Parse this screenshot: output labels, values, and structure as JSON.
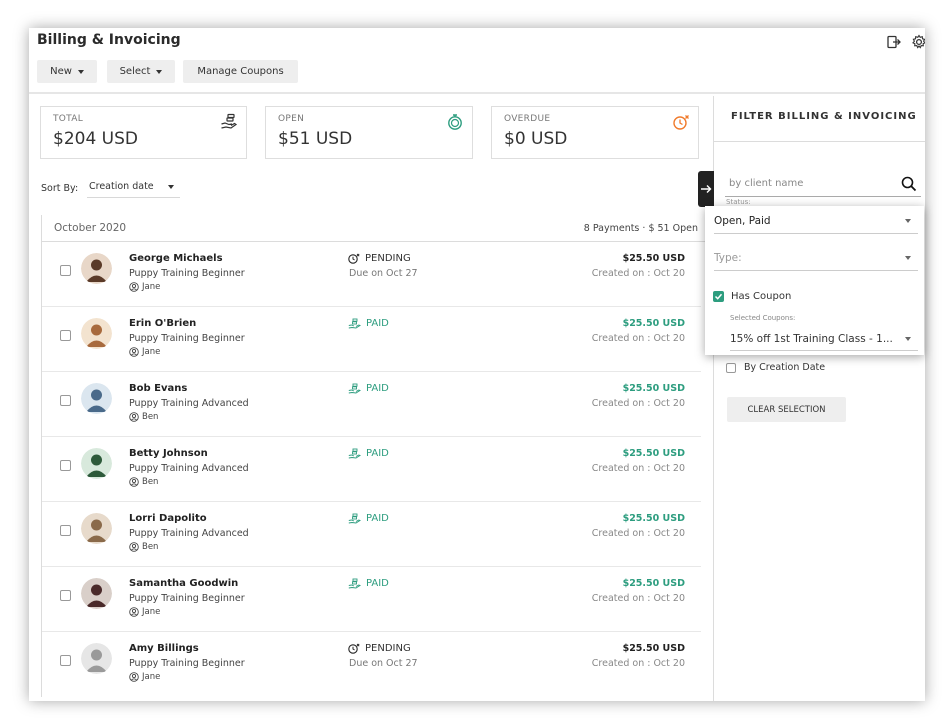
{
  "header": {
    "title": "Billing & Invoicing",
    "buttons": {
      "new": "New",
      "select": "Select",
      "manage_coupons": "Manage Coupons"
    }
  },
  "summary": [
    {
      "label": "TOTAL",
      "value": "$204 USD",
      "icon": "hand-money-icon",
      "color": "#333333"
    },
    {
      "label": "OPEN",
      "value": "$51 USD",
      "icon": "stopwatch-icon",
      "color": "#2d9d7f"
    },
    {
      "label": "OVERDUE",
      "value": "$0 USD",
      "icon": "clock-alert-icon",
      "color": "#f07a2b"
    }
  ],
  "sort": {
    "label": "Sort By:",
    "value": "Creation date"
  },
  "group": {
    "month": "October 2020",
    "summary": "8 Payments   ·  $ 51 Open"
  },
  "payments": [
    {
      "name": "George Michaels",
      "plan": "Puppy Training Beginner",
      "trainer": "Jane",
      "status": "PENDING",
      "due": "Due on Oct 27",
      "amount": "$25.50 USD",
      "created": "Created on : Oct 20"
    },
    {
      "name": "Erin O'Brien",
      "plan": "Puppy Training Beginner",
      "trainer": "Jane",
      "status": "PAID",
      "due": "",
      "amount": "$25.50 USD",
      "created": "Created on : Oct 20"
    },
    {
      "name": "Bob Evans",
      "plan": "Puppy Training Advanced",
      "trainer": "Ben",
      "status": "PAID",
      "due": "",
      "amount": "$25.50 USD",
      "created": "Created on : Oct 20"
    },
    {
      "name": "Betty Johnson",
      "plan": "Puppy Training Advanced",
      "trainer": "Ben",
      "status": "PAID",
      "due": "",
      "amount": "$25.50 USD",
      "created": "Created on : Oct 20"
    },
    {
      "name": "Lorri Dapolito",
      "plan": "Puppy Training Advanced",
      "trainer": "Ben",
      "status": "PAID",
      "due": "",
      "amount": "$25.50 USD",
      "created": "Created on : Oct 20"
    },
    {
      "name": "Samantha Goodwin",
      "plan": "Puppy Training Beginner",
      "trainer": "Jane",
      "status": "PAID",
      "due": "",
      "amount": "$25.50 USD",
      "created": "Created on : Oct 20"
    },
    {
      "name": "Amy Billings",
      "plan": "Puppy Training Beginner",
      "trainer": "Jane",
      "status": "PENDING",
      "due": "Due on Oct 27",
      "amount": "$25.50 USD",
      "created": "Created on : Oct 20"
    }
  ],
  "filter": {
    "title": "FILTER BILLING & INVOICING",
    "search_placeholder": "by client name",
    "status_label": "Status:",
    "status_value": "Open, Paid",
    "type_placeholder": "Type:",
    "has_coupon_label": "Has Coupon",
    "selected_coupons_label": "Selected Coupons:",
    "selected_coupon_value": "15% off 1st Training Class - 1...",
    "by_creation_label": "By Creation Date",
    "clear_label": "CLEAR SELECTION"
  },
  "colors": {
    "paid": "#2d9d7f",
    "overdue": "#f07a2b",
    "text": "#333333"
  }
}
